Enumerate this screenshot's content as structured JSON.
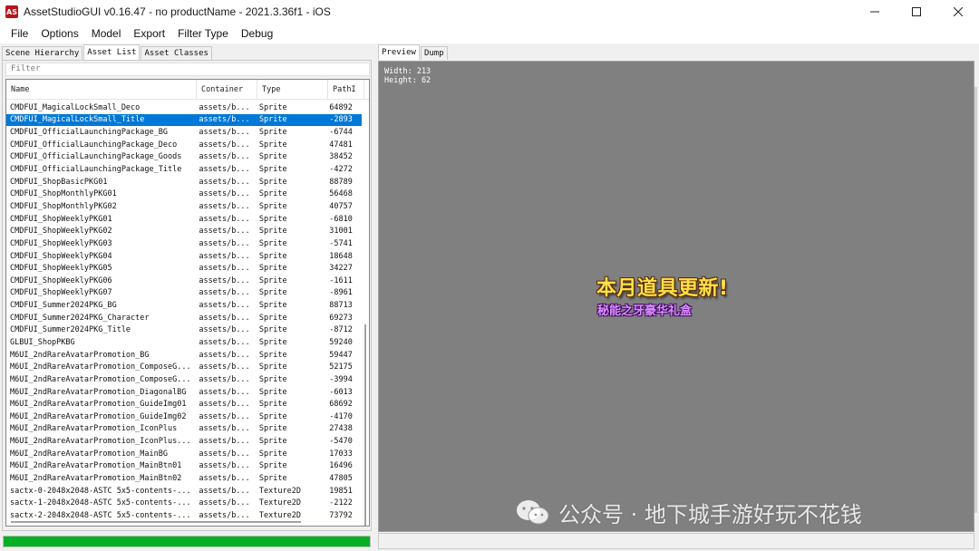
{
  "window": {
    "title": "AssetStudioGUI v0.16.47 - no productName - 2021.3.36f1 - iOS",
    "icon_text": "AS",
    "controls": [
      "minimize-icon",
      "maximize-icon",
      "close-icon"
    ]
  },
  "menu": [
    "File",
    "Options",
    "Model",
    "Export",
    "Filter Type",
    "Debug"
  ],
  "left_tabs": [
    "Scene Hierarchy",
    "Asset List",
    "Asset Classes"
  ],
  "filter": {
    "placeholder": "Filter"
  },
  "columns": [
    "Name",
    "Container",
    "Type",
    "PathI"
  ],
  "rows": [
    [
      "CMDFUI_MagicalLockSmall_Deco",
      "assets/b...",
      "Sprite",
      "64892"
    ],
    [
      "CMDFUI_MagicalLockSmall_Title",
      "assets/b...",
      "Sprite",
      "-2893"
    ],
    [
      "CMDFUI_OfficialLaunchingPackage_BG",
      "assets/b...",
      "Sprite",
      "-6744"
    ],
    [
      "CMDFUI_OfficialLaunchingPackage_Deco",
      "assets/b...",
      "Sprite",
      "47481"
    ],
    [
      "CMDFUI_OfficialLaunchingPackage_Goods",
      "assets/b...",
      "Sprite",
      "38452"
    ],
    [
      "CMDFUI_OfficialLaunchingPackage_Title",
      "assets/b...",
      "Sprite",
      "-4272"
    ],
    [
      "CMDFUI_ShopBasicPKG01",
      "assets/b...",
      "Sprite",
      "88789"
    ],
    [
      "CMDFUI_ShopMonthlyPKG01",
      "assets/b...",
      "Sprite",
      "56468"
    ],
    [
      "CMDFUI_ShopMonthlyPKG02",
      "assets/b...",
      "Sprite",
      "40757"
    ],
    [
      "CMDFUI_ShopWeeklyPKG01",
      "assets/b...",
      "Sprite",
      "-6810"
    ],
    [
      "CMDFUI_ShopWeeklyPKG02",
      "assets/b...",
      "Sprite",
      "31001"
    ],
    [
      "CMDFUI_ShopWeeklyPKG03",
      "assets/b...",
      "Sprite",
      "-5741"
    ],
    [
      "CMDFUI_ShopWeeklyPKG04",
      "assets/b...",
      "Sprite",
      "18648"
    ],
    [
      "CMDFUI_ShopWeeklyPKG05",
      "assets/b...",
      "Sprite",
      "34227"
    ],
    [
      "CMDFUI_ShopWeeklyPKG06",
      "assets/b...",
      "Sprite",
      "-1611"
    ],
    [
      "CMDFUI_ShopWeeklyPKG07",
      "assets/b...",
      "Sprite",
      "-8961"
    ],
    [
      "CMDFUI_Summer2024PKG_BG",
      "assets/b...",
      "Sprite",
      "88713"
    ],
    [
      "CMDFUI_Summer2024PKG_Character",
      "assets/b...",
      "Sprite",
      "69273"
    ],
    [
      "CMDFUI_Summer2024PKG_Title",
      "assets/b...",
      "Sprite",
      "-8712"
    ],
    [
      "GLBUI_ShopPKBG",
      "assets/b...",
      "Sprite",
      "59240"
    ],
    [
      "M6UI_2ndRareAvatarPromotion_BG",
      "assets/b...",
      "Sprite",
      "59447"
    ],
    [
      "M6UI_2ndRareAvatarPromotion_ComposeG...",
      "assets/b...",
      "Sprite",
      "52175"
    ],
    [
      "M6UI_2ndRareAvatarPromotion_ComposeG...",
      "assets/b...",
      "Sprite",
      "-3994"
    ],
    [
      "M6UI_2ndRareAvatarPromotion_DiagonalBG",
      "assets/b...",
      "Sprite",
      "-6013"
    ],
    [
      "M6UI_2ndRareAvatarPromotion_GuideImg01",
      "assets/b...",
      "Sprite",
      "68692"
    ],
    [
      "M6UI_2ndRareAvatarPromotion_GuideImg02",
      "assets/b...",
      "Sprite",
      "-4170"
    ],
    [
      "M6UI_2ndRareAvatarPromotion_IconPlus",
      "assets/b...",
      "Sprite",
      "27438"
    ],
    [
      "M6UI_2ndRareAvatarPromotion_IconPlus...",
      "assets/b...",
      "Sprite",
      "-5470"
    ],
    [
      "M6UI_2ndRareAvatarPromotion_MainBG",
      "assets/b...",
      "Sprite",
      "17033"
    ],
    [
      "M6UI_2ndRareAvatarPromotion_MainBtn01",
      "assets/b...",
      "Sprite",
      "16496"
    ],
    [
      "M6UI_2ndRareAvatarPromotion_MainBtn02",
      "assets/b...",
      "Sprite",
      "47805"
    ],
    [
      "sactx-0-2048x2048-ASTC 5x5-contents-...",
      "assets/b...",
      "Texture2D",
      "19851"
    ],
    [
      "sactx-1-2048x2048-ASTC 5x5-contents-...",
      "assets/b...",
      "Texture2D",
      "-2122"
    ],
    [
      "sactx-2-2048x2048-ASTC 5x5-contents-...",
      "assets/b...",
      "Texture2D",
      "73792"
    ]
  ],
  "selected_row": 1,
  "right_tabs": [
    "Preview",
    "Dump"
  ],
  "preview": {
    "info": [
      "Width: 213",
      "Height: 62"
    ],
    "sprite_title": "本月道具更新!",
    "sprite_subtitle": "秘能之牙豪华礼盒"
  },
  "progress": {
    "value": 1.0,
    "color": "#06b025"
  },
  "watermark": "公众号 · 地下城手游好玩不花钱",
  "colors": {
    "selection": "#0078d7",
    "preview_bg": "#808080"
  }
}
